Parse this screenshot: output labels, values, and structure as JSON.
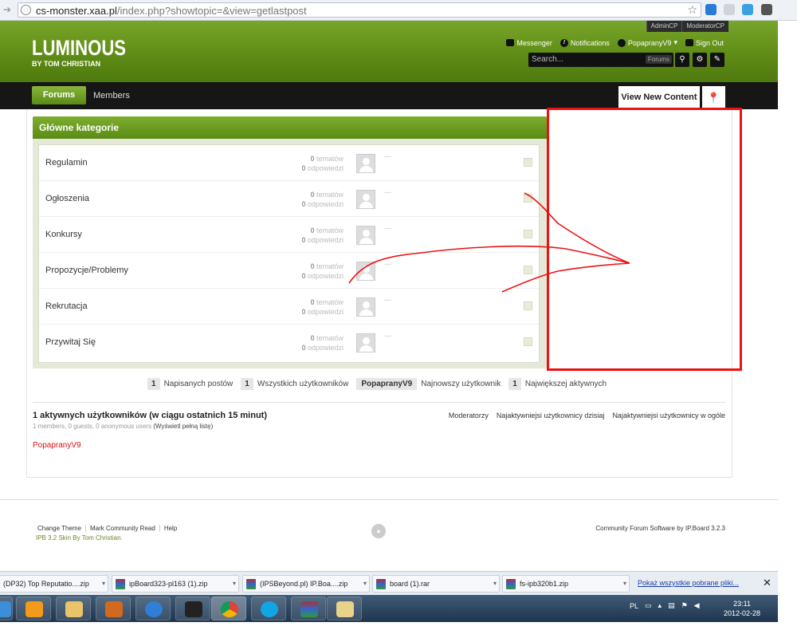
{
  "browser": {
    "url_host": "cs-monster.xaa.pl",
    "url_path": "/index.php?showtopic=&view=getlastpost"
  },
  "header": {
    "logo_title": "LUMINOUS",
    "logo_subtitle": "BY TOM CHRISTIAN",
    "admin_links": [
      "AdminCP",
      "ModeratorCP"
    ],
    "user_links": {
      "messenger": "Messenger",
      "notifications": "Notifications",
      "username": "PopapranyV9",
      "sign_out": "Sign Out"
    },
    "search_placeholder": "Search...",
    "search_scope": "Forums"
  },
  "nav": {
    "tabs": [
      {
        "label": "Forums",
        "active": true
      },
      {
        "label": "Members",
        "active": false
      }
    ],
    "view_new": "View New Content"
  },
  "category": {
    "title": "Główne kategorie",
    "forums": [
      {
        "name": "Regulamin",
        "topics": "0",
        "topics_label": "tematów",
        "replies": "0",
        "replies_label": "odpowiedzi",
        "last": "---"
      },
      {
        "name": "Ogłoszenia",
        "topics": "0",
        "topics_label": "tematów",
        "replies": "0",
        "replies_label": "odpowiedzi",
        "last": "---"
      },
      {
        "name": "Konkursy",
        "topics": "0",
        "topics_label": "tematów",
        "replies": "0",
        "replies_label": "odpowiedzi",
        "last": "---"
      },
      {
        "name": "Propozycje/Problemy",
        "topics": "0",
        "topics_label": "tematów",
        "replies": "0",
        "replies_label": "odpowiedzi",
        "last": "---"
      },
      {
        "name": "Rekrutacja",
        "topics": "0",
        "topics_label": "tematów",
        "replies": "0",
        "replies_label": "odpowiedzi",
        "last": "---"
      },
      {
        "name": "Przywitaj Się",
        "topics": "0",
        "topics_label": "tematów",
        "replies": "0",
        "replies_label": "odpowiedzi",
        "last": "---"
      }
    ]
  },
  "stats": {
    "posts_count": "1",
    "posts_label": "Napisanych postów",
    "users_count": "1",
    "users_label": "Wszystkich użytkowników",
    "newest_user": "PopapranyV9",
    "newest_label": "Najnowszy użytkownik",
    "most_online": "1",
    "most_online_label": "Największej aktywnych"
  },
  "active_users": {
    "title": "1 aktywnych użytkowników (w ciągu ostatnich 15 minut)",
    "summary": "1 members, 0 guests, 0 anonymous users",
    "full_list": "(Wyświetl pełną listę)",
    "links": [
      "Moderatorzy",
      "Najaktywniejsi użytkownicy dzisiaj",
      "Najaktywniejsi użytkownicy w ogóle"
    ],
    "online_user": "PopapranyV9"
  },
  "footer": {
    "links": [
      "Change Theme",
      "Mark Community Read",
      "Help"
    ],
    "skin": "IPB 3.2 Skin By Tom Christian.",
    "powered": "Community Forum Software by IP.Board 3.2.3"
  },
  "downloads": {
    "items": [
      "(DP32) Top Reputatio....zip",
      "ipBoard323-pl163 (1).zip",
      "(IPSBeyond.pl) IP.Boa....zip",
      "board (1).rar",
      "fs-ipb320b1.zip"
    ],
    "show_all": "Pokaż wszystkie pobrane pliki...",
    "close": "✕"
  },
  "taskbar": {
    "lang": "PL",
    "time": "23:11",
    "date": "2012-02-28"
  },
  "colors": {
    "brand_green": "#5d8a14",
    "annotation_red": "#e11111"
  }
}
